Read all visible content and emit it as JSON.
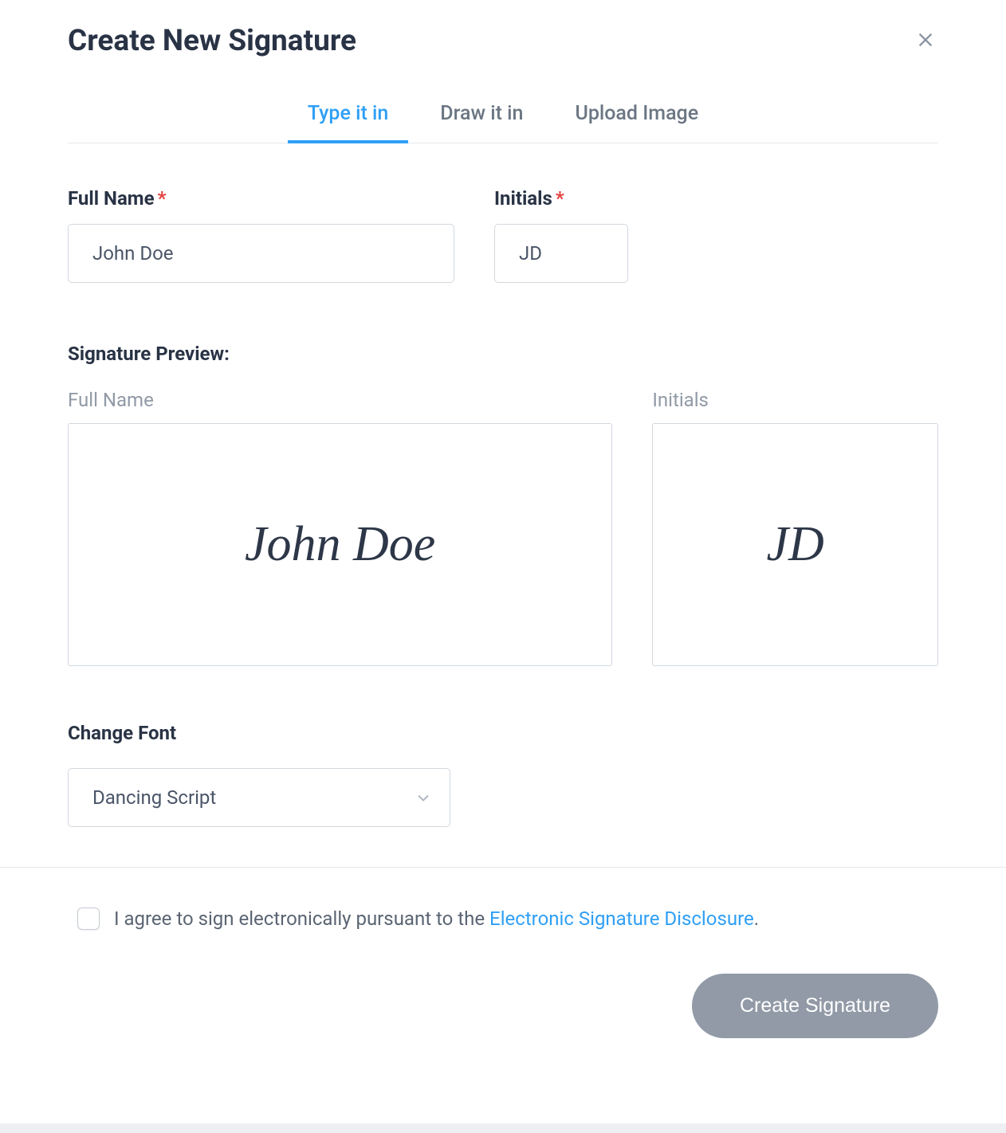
{
  "header": {
    "title": "Create New Signature"
  },
  "tabs": [
    {
      "label": "Type it in",
      "active": true
    },
    {
      "label": "Draw it in",
      "active": false
    },
    {
      "label": "Upload Image",
      "active": false
    }
  ],
  "form": {
    "fullname_label": "Full Name",
    "fullname_value": "John Doe",
    "initials_label": "Initials",
    "initials_value": "JD"
  },
  "preview": {
    "section_title": "Signature Preview:",
    "fullname_label": "Full Name",
    "fullname_value": "John Doe",
    "initials_label": "Initials",
    "initials_value": "JD"
  },
  "font": {
    "label": "Change Font",
    "selected": "Dancing Script"
  },
  "footer": {
    "agree_text_pre": "I agree to sign electronically pursuant to the ",
    "agree_link": "Electronic Signature Disclosure",
    "agree_text_post": ".",
    "create_label": "Create Signature"
  }
}
